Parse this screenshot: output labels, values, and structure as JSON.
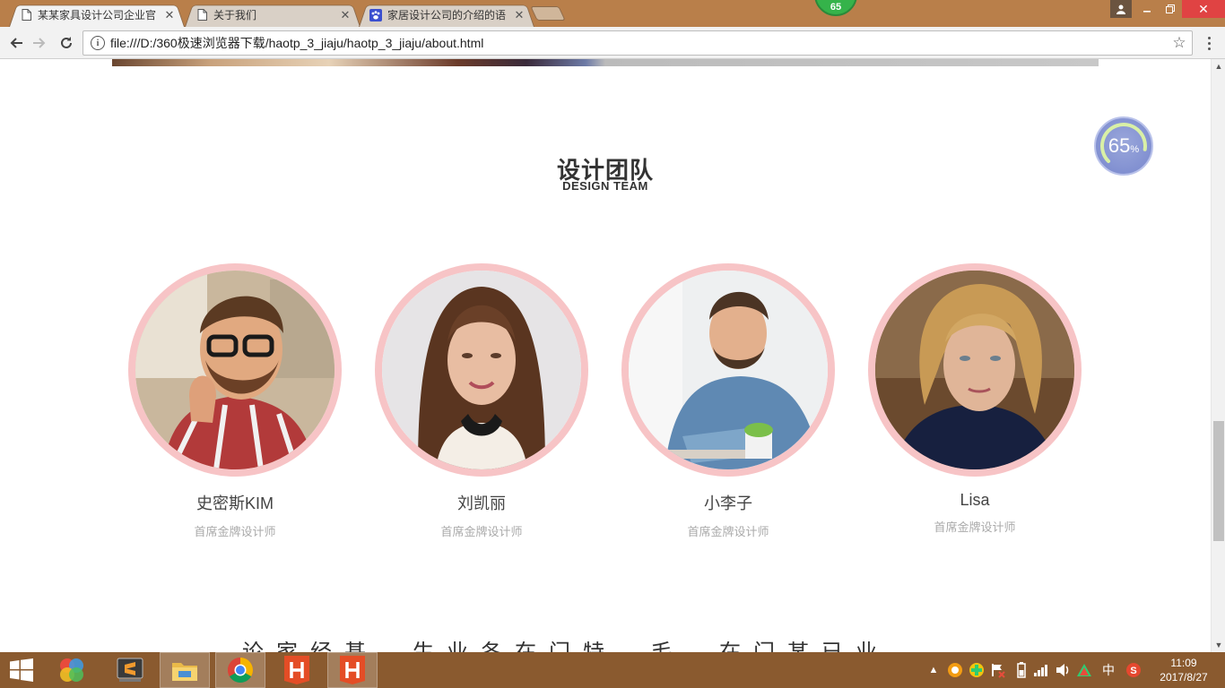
{
  "browser": {
    "tabs": [
      {
        "title": "某某家具设计公司企业官",
        "active": true,
        "icon": "page-icon"
      },
      {
        "title": "关于我们",
        "active": false,
        "icon": "page-icon"
      },
      {
        "title": "家居设计公司的介绍的语",
        "active": false,
        "icon": "paw-icon"
      }
    ],
    "badge": "65",
    "url": "file:///D:/360极速浏览器下载/haotp_3_jiaju/haotp_3_jiaju/about.html"
  },
  "page": {
    "progress_widget": {
      "value": "65",
      "unit": "%"
    },
    "section_title": "设计团队",
    "section_subtitle": "DESIGN TEAM",
    "members": [
      {
        "name": "史密斯KIM",
        "role": "首席金牌设计师"
      },
      {
        "name": "刘凯丽",
        "role": "首席金牌设计师"
      },
      {
        "name": "小李子",
        "role": "首席金牌设计师"
      },
      {
        "name": "Lisa",
        "role": "首席金牌设计师"
      }
    ],
    "footer_scribble": "论家经基，生业各在门特，毛，在门某已业"
  },
  "taskbar": {
    "apps": [
      "app-icon-colorful",
      "sublime-text-icon",
      "file-explorer-icon",
      "chrome-icon",
      "hbuilder-icon",
      "hbuilder-icon"
    ],
    "tray": {
      "ime": "中"
    },
    "clock": {
      "time": "11:09",
      "date": "2017/8/27"
    }
  },
  "colors": {
    "titlebar": "#b97f4a",
    "taskbar": "#8a5a2f",
    "photo_ring": "#f7c4c6",
    "close_button": "#e04343"
  }
}
